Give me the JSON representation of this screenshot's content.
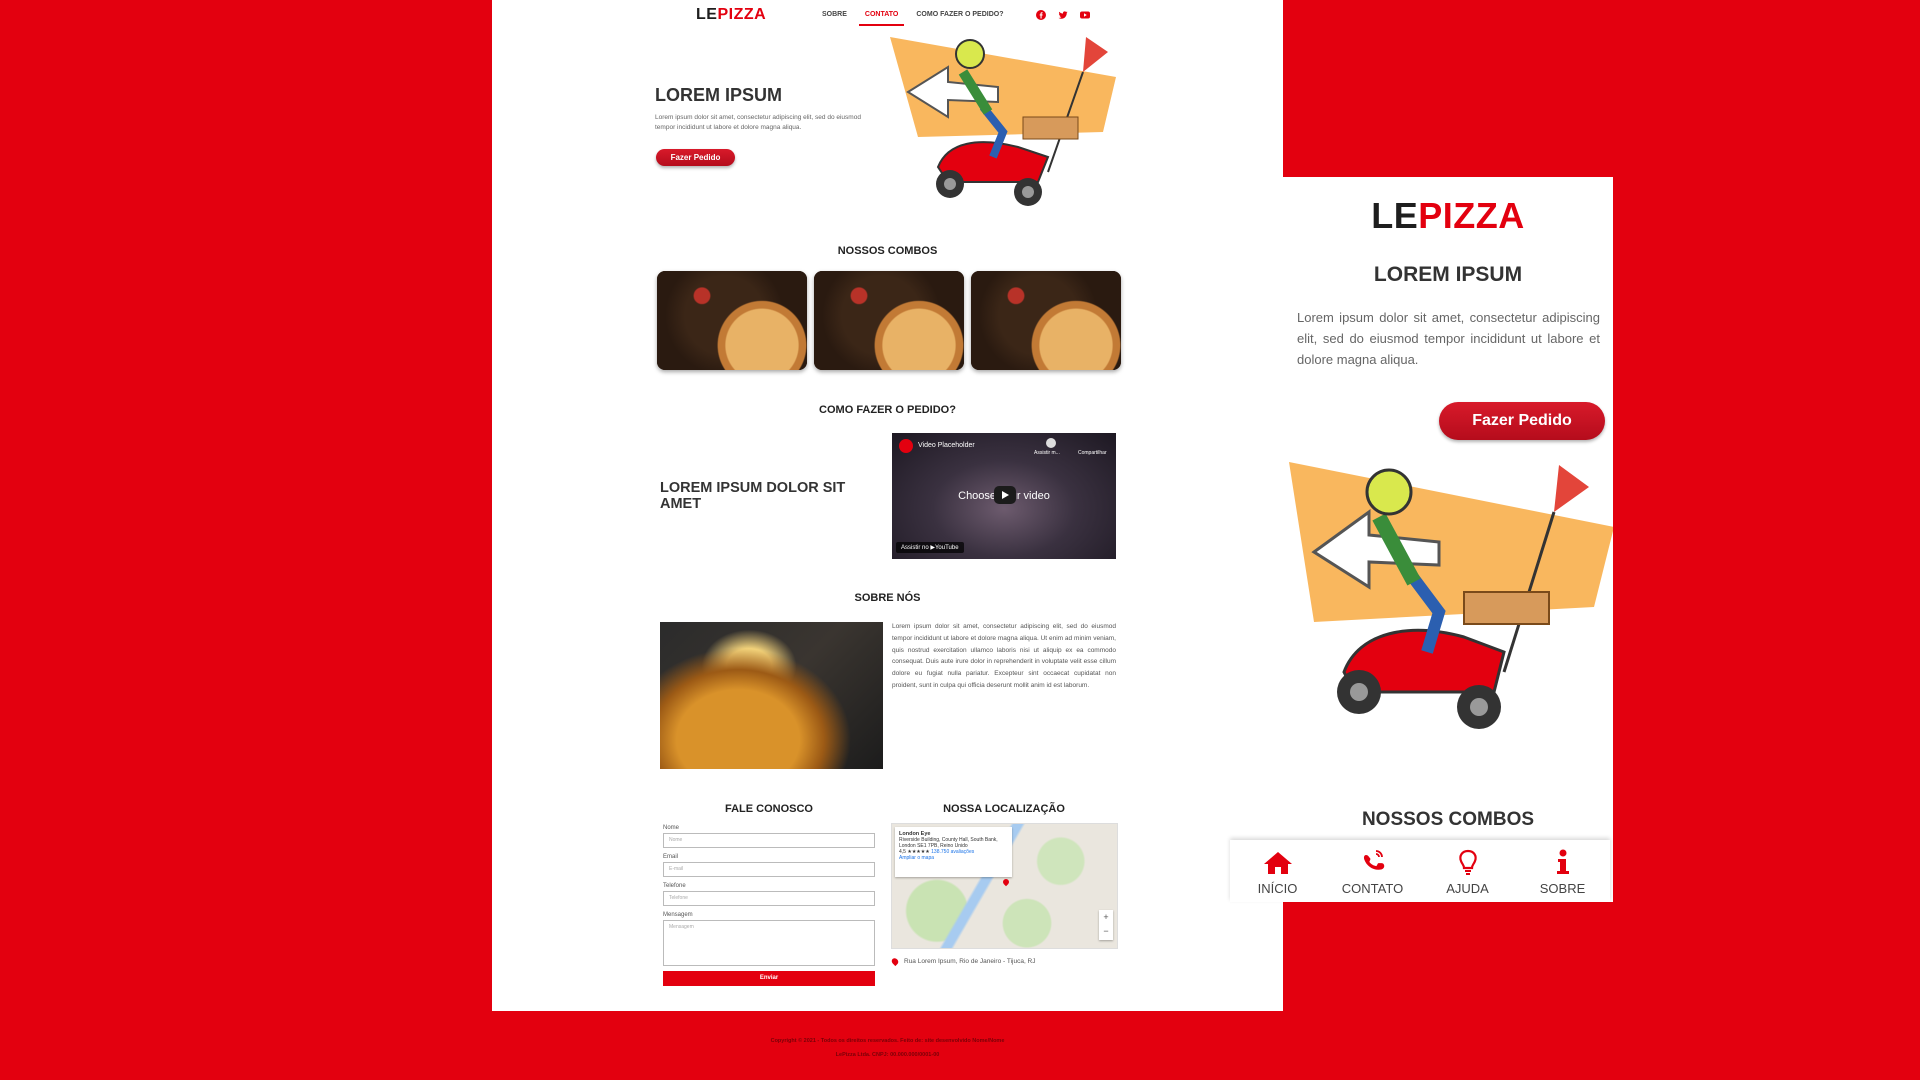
{
  "brand": {
    "logo_le": "LE",
    "logo_pizza": "PIZZA"
  },
  "desktop": {
    "nav": [
      {
        "label": "SOBRE",
        "active": false
      },
      {
        "label": "CONTATO",
        "active": true
      },
      {
        "label": "COMO FAZER O PEDIDO?",
        "active": false
      }
    ],
    "social": [
      "facebook-icon",
      "twitter-icon",
      "youtube-icon"
    ],
    "hero": {
      "title": "LOREM IPSUM",
      "text": "Lorem ipsum dolor sit amet, consectetur adipiscing elit, sed do eiusmod tempor incididunt ut labore et dolore magna aliqua.",
      "button": "Fazer Pedido"
    },
    "combos_title": "NOSSOS COMBOS",
    "how": {
      "title": "COMO FAZER O PEDIDO?",
      "text": "LOREM IPSUM DOLOR SIT AMET",
      "video_title": "Video Placeholder",
      "video_center": "Choose your video",
      "video_later": "Assistir m...",
      "video_share": "Compartilhar",
      "video_watch": "Assistir no ▶YouTube"
    },
    "about": {
      "title": "SOBRE NÓS",
      "text": "Lorem ipsum dolor sit amet, consectetur adipiscing elit, sed do eiusmod tempor incididunt ut labore et dolore magna aliqua. Ut enim ad minim veniam, quis nostrud exercitation ullamco laboris nisi ut aliquip ex ea commodo consequat. Duis aute irure dolor in reprehenderit in voluptate velit esse cillum dolore eu fugiat nulla pariatur. Excepteur sint occaecat cupidatat non proident, sunt in culpa qui officia deserunt mollit anim id est laborum."
    },
    "contact": {
      "title": "FALE CONOSCO",
      "name_label": "Nome",
      "name_placeholder": "Nome",
      "email_label": "Email",
      "email_placeholder": "E-mail",
      "phone_label": "Telefone",
      "phone_placeholder": "Telefone",
      "message_label": "Mensagem",
      "message_placeholder": "Mensagem",
      "send": "Enviar"
    },
    "map": {
      "title": "NOSSA LOCALIZAÇÃO",
      "place": "London Eye",
      "place_address": "Riverside Building, County Hall, South Bank, London SE1 7PB, Reino Unido",
      "rating": "4,5 ★★★★★",
      "reviews": "138.750 avaliações",
      "enlarge": "Ampliar o mapa",
      "address": "Rua Lorem Ipsum, Rio de Janeiro - Tijuca, RJ"
    },
    "footer": {
      "line1": "Copyright © 2021 - Todos os direitos reservados. Feito de: site desenvolvido Nome/Nome",
      "line2": "LePizza Ltda. CNPJ: 00.000.000/0001-00"
    }
  },
  "mobile": {
    "title": "LOREM IPSUM",
    "text": "Lorem ipsum dolor sit amet, consectetur adipiscing elit, sed do eiusmod tempor incididunt ut labore et dolore magna aliqua.",
    "button": "Fazer Pedido",
    "combos_title": "NOSSOS COMBOS",
    "tabs": [
      {
        "label": "INÍCIO",
        "icon": "home-icon"
      },
      {
        "label": "CONTATO",
        "icon": "phone-icon"
      },
      {
        "label": "AJUDA",
        "icon": "lightbulb-icon"
      },
      {
        "label": "SOBRE",
        "icon": "info-icon"
      }
    ]
  },
  "colors": {
    "accent": "#e3000f",
    "button": "#c8102e",
    "illustration_orange": "#f9b75e"
  }
}
